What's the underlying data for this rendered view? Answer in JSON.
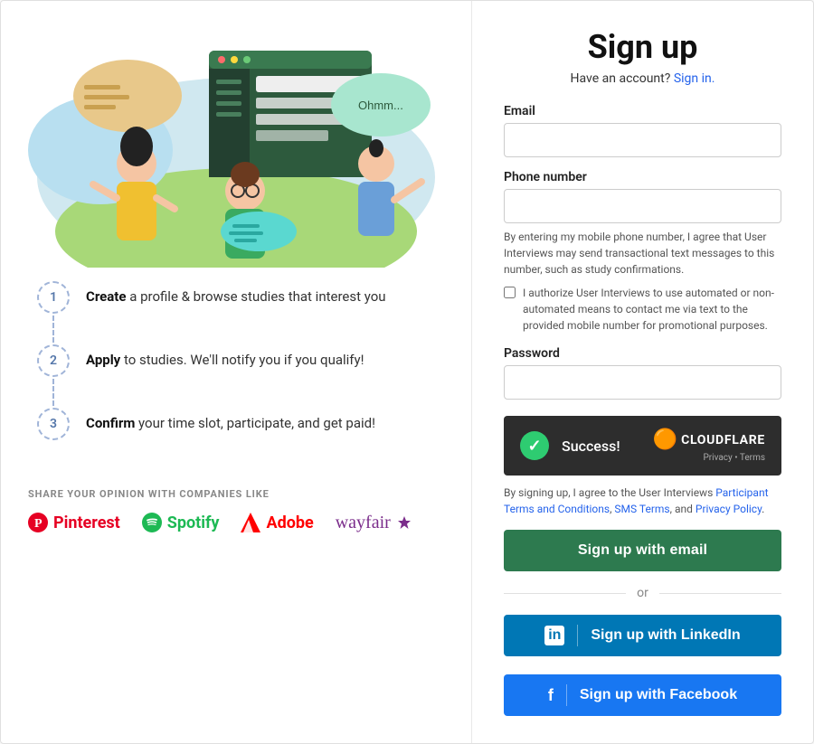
{
  "left": {
    "steps": [
      {
        "number": "1",
        "bold": "Create",
        "text": " a profile & browse studies that interest you"
      },
      {
        "number": "2",
        "bold": "Apply",
        "text": " to studies. We'll notify you if you qualify!"
      },
      {
        "number": "3",
        "bold": "Confirm",
        "text": " your time slot, participate, and get paid!"
      }
    ],
    "brands_label": "SHARE YOUR OPINION WITH COMPANIES LIKE",
    "brands": [
      {
        "name": "Pinterest",
        "class": "brand-pinterest"
      },
      {
        "name": "Spotify",
        "class": "brand-spotify"
      },
      {
        "name": "Adobe",
        "class": "brand-adobe"
      },
      {
        "name": "wayfair",
        "class": "brand-wayfair"
      }
    ]
  },
  "right": {
    "title": "Sign up",
    "have_account_text": "Have an account?",
    "sign_in_label": "Sign in.",
    "email_label": "Email",
    "email_placeholder": "",
    "phone_label": "Phone number",
    "phone_placeholder": "",
    "phone_note": "By entering my mobile phone number, I agree that User Interviews may send transactional text messages to this number, such as study confirmations.",
    "checkbox_label": "I authorize User Interviews to use automated or non-automated means to contact me via text to the provided mobile number for promotional purposes.",
    "password_label": "Password",
    "password_placeholder": "",
    "cloudflare_success": "Success!",
    "cloudflare_brand": "CLOUDFLARE",
    "cloudflare_links": "Privacy • Terms",
    "terms_text_1": "By signing up, I agree to the User Interviews ",
    "terms_link1": "Participant Terms and Conditions",
    "terms_text_2": ", ",
    "terms_link2": "SMS Terms",
    "terms_text_3": ", and ",
    "terms_link3": "Privacy Policy",
    "terms_text_4": ".",
    "btn_email": "Sign up with email",
    "or_label": "or",
    "btn_linkedin": "Sign up with LinkedIn",
    "btn_facebook": "Sign up with Facebook"
  }
}
